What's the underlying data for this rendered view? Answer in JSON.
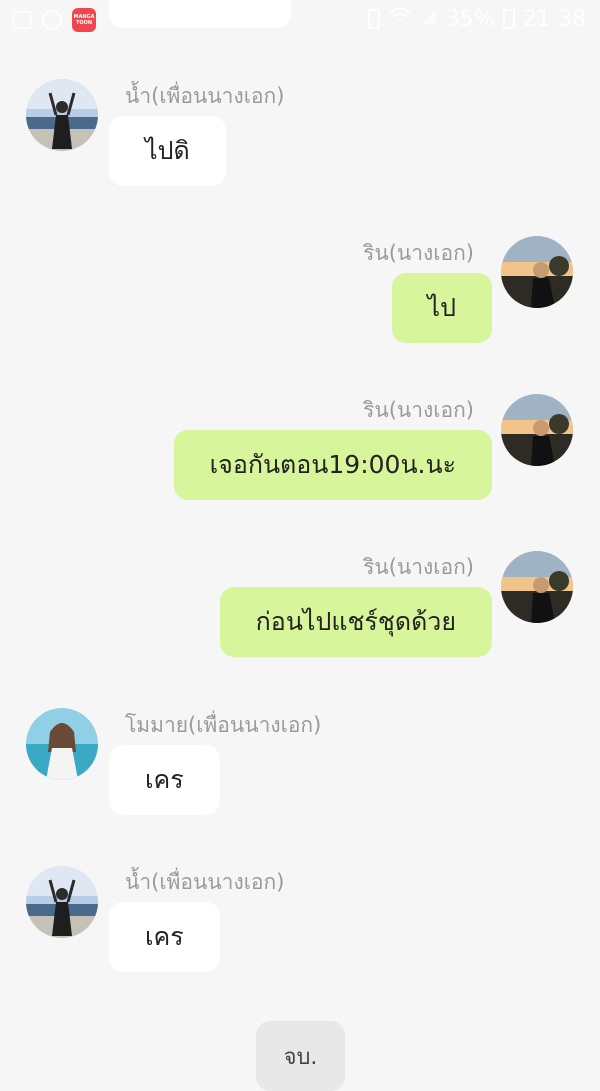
{
  "status_bar": {
    "app_icon_text_1": "MANGA",
    "app_icon_text_2": "TOON",
    "battery": "35%",
    "time": "21:38"
  },
  "messages": [
    {
      "side": "left",
      "sender": "น้ำ(เพื่อนนางเอก)",
      "text": "ไปดิ",
      "avatar": "beach-girl-icon"
    },
    {
      "side": "right",
      "sender": "ริน(นางเอก)",
      "text": "ไป",
      "avatar": "sunset-girl-icon"
    },
    {
      "side": "right",
      "sender": "ริน(นางเอก)",
      "text": "เจอกันตอน19:00น.นะ",
      "avatar": "sunset-girl-icon"
    },
    {
      "side": "right",
      "sender": "ริน(นางเอก)",
      "text": "ก่อนไปแชร์ชุดด้วย",
      "avatar": "sunset-girl-icon"
    },
    {
      "side": "left",
      "sender": "โมมาย(เพื่อนนางเอก)",
      "text": "เคร",
      "avatar": "seaside-girl-icon"
    },
    {
      "side": "left",
      "sender": "น้ำ(เพื่อนนางเอก)",
      "text": "เคร",
      "avatar": "beach-girl-icon"
    }
  ],
  "end_label": "จบ.",
  "colors": {
    "background": "#f6f6f6",
    "left_bubble": "#ffffff",
    "right_bubble": "#d7f59a",
    "name_text": "#9a9a9a"
  }
}
